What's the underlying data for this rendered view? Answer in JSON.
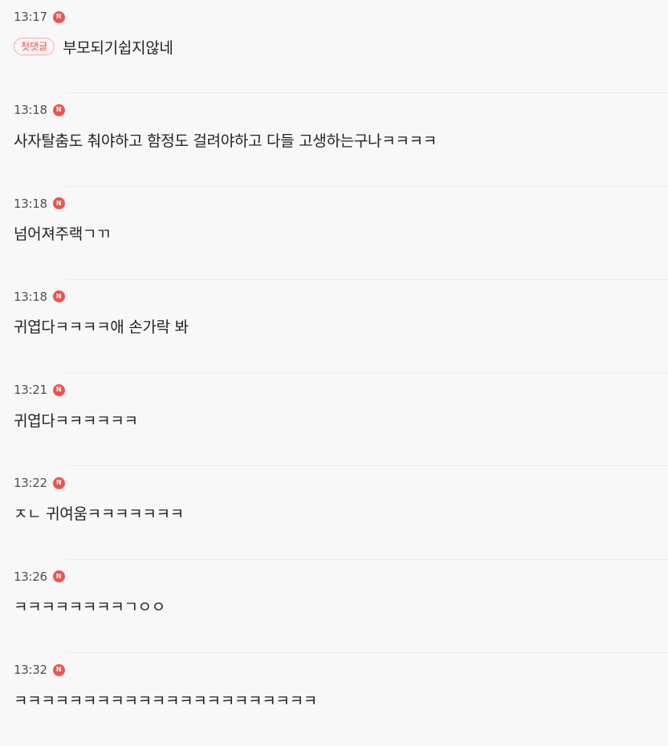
{
  "badge_letter": "N",
  "first_comment_label": "첫댓글",
  "colors": {
    "new_badge": "#ef5350",
    "first_comment_border": "#f4a8a8",
    "first_comment_text": "#e84a4a",
    "background": "#f8f8f8"
  },
  "comments": [
    {
      "time": "13:17",
      "text": "부모되기쉽지않네",
      "first_comment": true
    },
    {
      "time": "13:18",
      "text": "사자탈춤도 춰야하고 함정도 걸려야하고 다들 고생하는구나ㅋㅋㅋㅋ"
    },
    {
      "time": "13:18",
      "text": "넘어져주랙ㄱㄲ"
    },
    {
      "time": "13:18",
      "text": "귀엽다ㅋㅋㅋㅋ애 손가락 봐"
    },
    {
      "time": "13:21",
      "text": "귀엽다ㅋㅋㅋㅋㅋㅋ"
    },
    {
      "time": "13:22",
      "text": "ㅈㄴ 귀여움ㅋㅋㅋㅋㅋㅋㅋ"
    },
    {
      "time": "13:26",
      "text": "ㅋㅋㅋㅋㅋㅋㅋㅋㄱㅇㅇ"
    },
    {
      "time": "13:32",
      "text": "ㅋㅋㅋㅋㅋㅋㅋㅋㅋㅋㅋㅋㅋㅋㅋㅋㅋㅋㅋㅋㅋㅋ"
    }
  ]
}
